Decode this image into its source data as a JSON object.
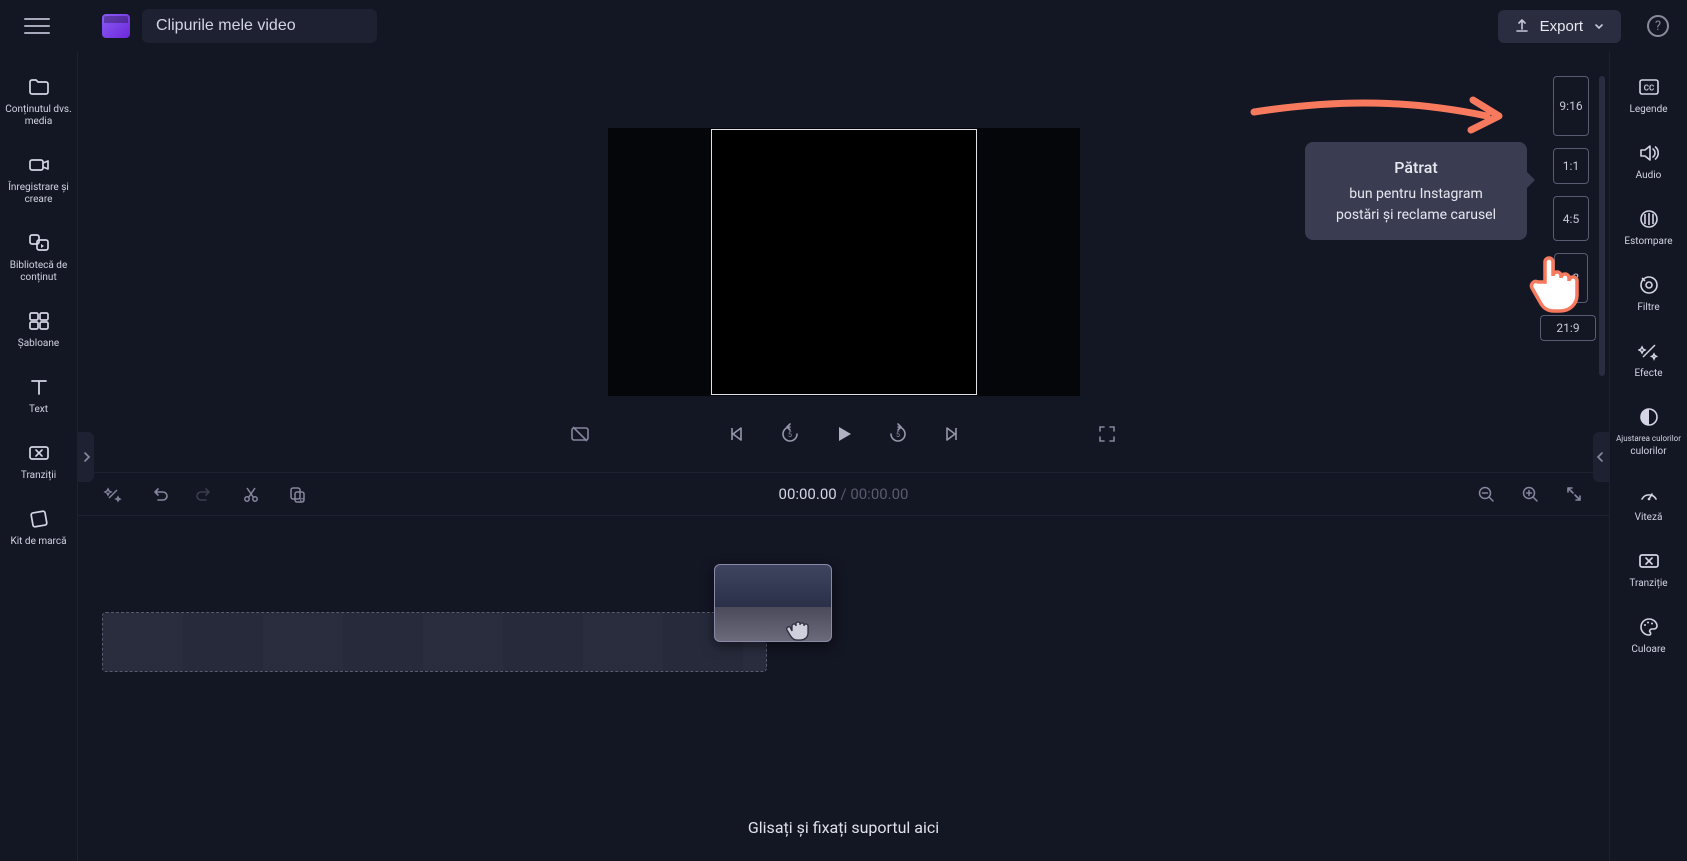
{
  "header": {
    "title": "Clipurile mele video",
    "export_label": "Export"
  },
  "left_sidebar": {
    "items": [
      {
        "label": "Conținutul dvs. media"
      },
      {
        "label": "Înregistrare și creare"
      },
      {
        "label": "Bibliotecă de conținut"
      },
      {
        "label": "Șabloane"
      },
      {
        "label": "Text"
      },
      {
        "label": "Tranziții"
      },
      {
        "label": "Kit de marcă"
      }
    ]
  },
  "right_sidebar": {
    "items": [
      {
        "label": "Legende"
      },
      {
        "label": "Audio"
      },
      {
        "label": "Estompare"
      },
      {
        "label": "Filtre"
      },
      {
        "label": "Efecte"
      },
      {
        "label": "Ajustarea culorilor",
        "label2": "culorilor"
      },
      {
        "label": "Viteză"
      },
      {
        "label": "Tranziție"
      },
      {
        "label": "Culoare"
      }
    ]
  },
  "aspect_ratios": {
    "r0": "9:16",
    "r1": "1:1",
    "r2": "4:5",
    "r3": "2:3",
    "r4": "21:9"
  },
  "tooltip": {
    "title": "Pătrat",
    "line1": "bun pentru Instagram",
    "line2": "postări și reclame carusel"
  },
  "timeline": {
    "current_time": "00:00.00",
    "separator": " / ",
    "total_time": "00:00.00",
    "hint": "Glisați și fixați suportul aici"
  },
  "colors": {
    "accent_arrow": "#f77a5e"
  }
}
